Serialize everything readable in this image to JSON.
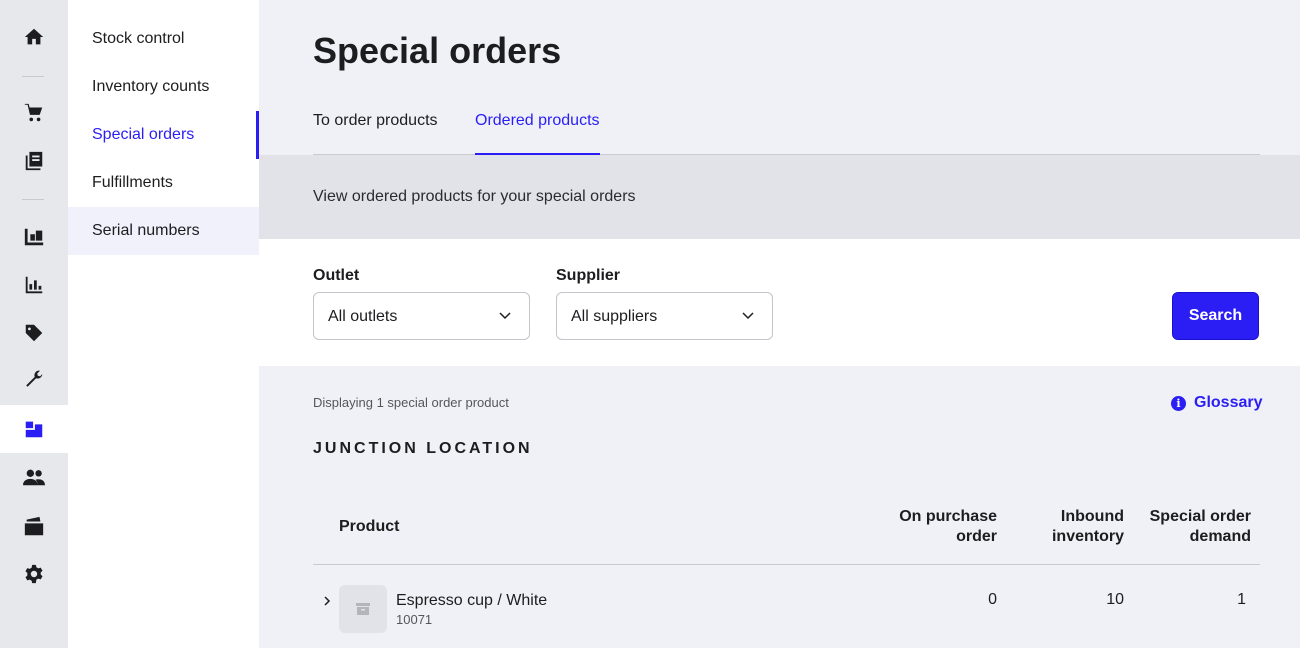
{
  "rail": {
    "items": [
      {
        "icon": "home-icon"
      },
      {
        "icon": "cart-icon"
      },
      {
        "icon": "register-icon"
      },
      {
        "icon": "inventory-icon"
      },
      {
        "icon": "reports-icon"
      },
      {
        "icon": "tag-icon"
      },
      {
        "icon": "wrench-icon"
      },
      {
        "icon": "boxes-icon",
        "active": true
      },
      {
        "icon": "customers-icon"
      },
      {
        "icon": "wallet-icon"
      },
      {
        "icon": "settings-icon"
      }
    ]
  },
  "subnav": {
    "items": [
      {
        "label": "Stock control"
      },
      {
        "label": "Inventory counts"
      },
      {
        "label": "Special orders",
        "active": true
      },
      {
        "label": "Fulfillments"
      },
      {
        "label": "Serial numbers"
      }
    ]
  },
  "page": {
    "title": "Special orders",
    "tabs": [
      {
        "label": "To order products"
      },
      {
        "label": "Ordered products",
        "active": true
      }
    ],
    "banner": "View ordered products for your special orders"
  },
  "filters": {
    "outlet_label": "Outlet",
    "outlet_value": "All outlets",
    "supplier_label": "Supplier",
    "supplier_value": "All suppliers",
    "search_label": "Search"
  },
  "results": {
    "count_text": "Displaying 1 special order product",
    "glossary_label": "Glossary",
    "location": "JUNCTION LOCATION"
  },
  "table": {
    "headers": {
      "product": "Product",
      "on_po_line1": "On purchase",
      "on_po_line2": "order",
      "inbound_line1": "Inbound",
      "inbound_line2": "inventory",
      "demand_line1": "Special order",
      "demand_line2": "demand"
    },
    "rows": [
      {
        "name": "Espresso cup / White",
        "sku": "10071",
        "on_purchase_order": "0",
        "inbound_inventory": "10",
        "special_order_demand": "1"
      }
    ]
  },
  "colors": {
    "accent": "#2a1ef5"
  }
}
